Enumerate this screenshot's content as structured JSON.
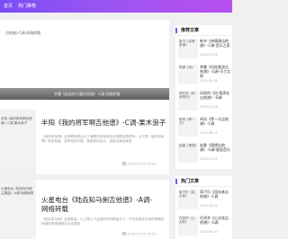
{
  "nav": {
    "home": "首页",
    "hot": "热门推荐"
  },
  "hero": {
    "top_caption": "古他曲)-C调-网络转载",
    "caption": "齐豫《苗苗的小鹿在他谱》-C调-网络转载"
  },
  "articles": [
    {
      "thumb_caption": "半阳 (我的将军啊吉他谱) -C调-果木浪子",
      "title": "半阳《我的将军啊吉他谱》-C调-果木浪子",
      "excerpt": "《我的将军啊》这首歌曲是由以下演唱的对我而言这首歌曲很好听。以下是《我的将军啊》的吉他谱，如有相关问题，直接联系站点，我给出最适宜的",
      "date": "2025-09-10 00:00"
    },
    {
      "thumb_caption": "火星电台 (陆垚知马俐主题曲) -A调-网络转载",
      "title": "火星电台《陆垚知马俐吉他谱》-A调-网络转载",
      "excerpt": "《陆垚知马俐》这首歌曲，以上是以下这首好听的歌曲生于。它的在弹法中我的弹唱吉他谱的原唱演唱中对这首歌",
      "date": "2025-07-25 09:57"
    }
  ],
  "sidebar": {
    "recommend_title": "推荐文章",
    "recommend": [
      {
        "thumb": "新书《亲情·家谱》",
        "text": "新书《亲情谱吉他谱》-C调-音乐之家",
        "date": "2025-07-08"
      },
      {
        "thumb": "李健《风》",
        "text": "李健《风吹麦浪吉他谱》-G调-马丁吉他",
        "date": "2025-08-04"
      },
      {
        "thumb": "风吹你《风·我再在》",
        "text": "风吹你《风·我再在吉他谱》-D调",
        "date": "2025-07-28"
      },
      {
        "thumb": "听风《等一天》",
        "text": "听风《等一天吉他谱》-C调",
        "date": "2025-08-11"
      },
      {
        "thumb": "赵雷《理想》",
        "text": "赵雷《理想吉他谱》-G调-星辰音乐",
        "date": "2025-07-31"
      }
    ],
    "hot_title": "热门文章",
    "hot": [
      {
        "thumb": "蒋子乐《游去者》",
        "text": "蒋子乐《游去者吉他谱》-C调",
        "date": "2025-06-12"
      },
      {
        "thumb": "任贤齐《心太软》",
        "text": "任贤齐《心太软吉他谱》-G调",
        "date": "2025-05-20"
      }
    ]
  }
}
